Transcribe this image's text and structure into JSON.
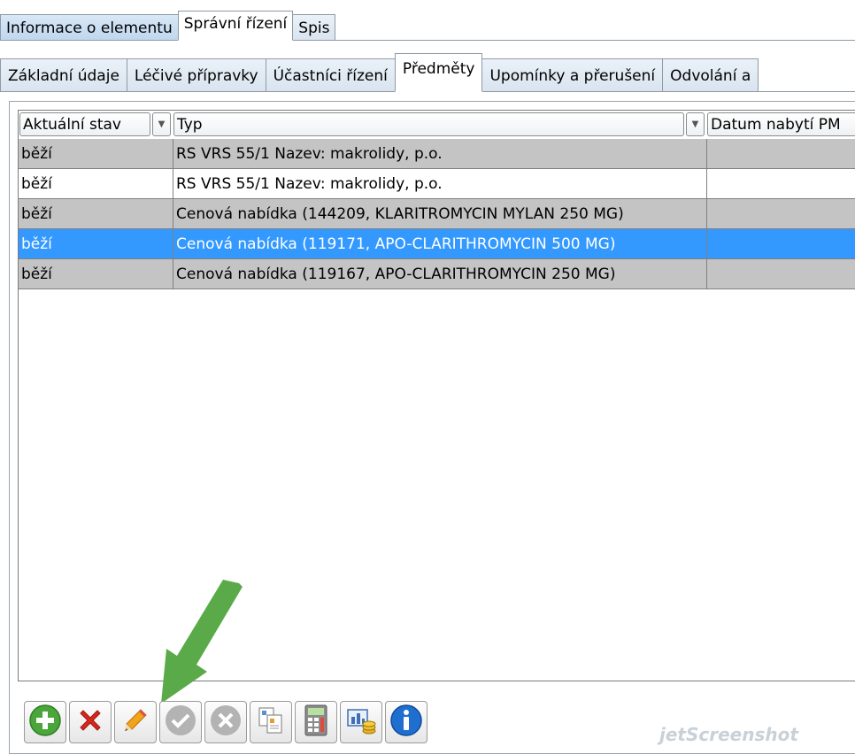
{
  "top_tabs": [
    {
      "label": "Informace o elementu"
    },
    {
      "label": "Správní řízení"
    },
    {
      "label": "Spis"
    }
  ],
  "sub_tabs": [
    {
      "label": "Základní údaje"
    },
    {
      "label": "Léčivé přípravky"
    },
    {
      "label": "Účastníci řízení"
    },
    {
      "label": "Předměty"
    },
    {
      "label": "Upomínky a přerušení"
    },
    {
      "label": "Odvolání a"
    }
  ],
  "table": {
    "columns": [
      "Aktuální stav",
      "Typ",
      "Datum nabytí PM"
    ],
    "rows": [
      {
        "stav": "běží",
        "typ": "RS VRS 55/1 Nazev: makrolidy, p.o.",
        "datum": ""
      },
      {
        "stav": "běží",
        "typ": "RS VRS 55/1 Nazev: makrolidy, p.o.",
        "datum": ""
      },
      {
        "stav": "běží",
        "typ": "Cenová nabídka (144209, KLARITROMYCIN MYLAN 250 MG)",
        "datum": ""
      },
      {
        "stav": "běží",
        "typ": "Cenová nabídka (119171, APO-CLARITHROMYCIN 500 MG)",
        "datum": ""
      },
      {
        "stav": "běží",
        "typ": "Cenová nabídka (119167, APO-CLARITHROMYCIN 250 MG)",
        "datum": ""
      }
    ],
    "selected_row": 3
  },
  "toolbar": [
    {
      "icon": "add-icon"
    },
    {
      "icon": "delete-icon"
    },
    {
      "icon": "pencil-icon"
    },
    {
      "icon": "check-icon"
    },
    {
      "icon": "cancel-icon"
    },
    {
      "icon": "copy-document-icon"
    },
    {
      "icon": "calculator-icon"
    },
    {
      "icon": "chart-coins-icon"
    },
    {
      "icon": "info-icon"
    }
  ],
  "watermark": "jetScreenshot",
  "colors": {
    "selection": "#3399ff",
    "row_gray": "#c4c4c4",
    "arrow": "#5aaa4a",
    "tab_blue": "#c8dcf0"
  }
}
